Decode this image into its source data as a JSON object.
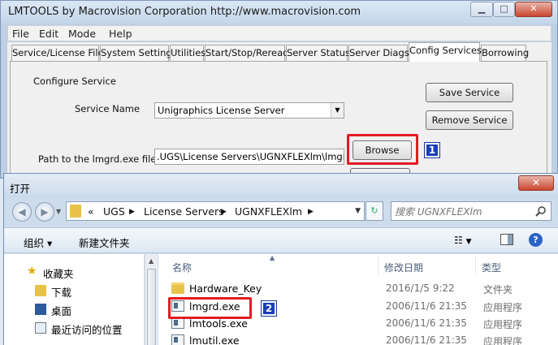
{
  "lmtools": {
    "title": "LMTOOLS by Macrovision Corporation http://www.macrovision.com",
    "menu": [
      "File",
      "Edit",
      "Mode",
      "Help"
    ],
    "tabs": [
      "Service/License File",
      "System Settings",
      "Utilities",
      "Start/Stop/Reread",
      "Server Status",
      "Server Diags",
      "Config Services",
      "Borrowing"
    ],
    "active_tab": "Config Services",
    "panel": {
      "group_label": "Configure Service",
      "service_name_label": "Service Name",
      "service_name_value": "Unigraphics License Server",
      "path_label": "Path to the lmgrd.exe file",
      "path_value": ".UGS\\License Servers\\UGNXFLEXlm\\lmgrd.exe",
      "save_service": "Save Service",
      "remove_service": "Remove Service",
      "browse": "Browse",
      "badge_1": "1"
    }
  },
  "dialog": {
    "title": "打开",
    "breadcrumb": [
      "«",
      "UGS",
      "License Servers",
      "UGNXFLEXlm"
    ],
    "search_placeholder": "搜索 UGNXFLEXlm",
    "toolbar": {
      "organize": "组织 ▾",
      "new_folder": "新建文件夹"
    },
    "nav_items": [
      "收藏夹",
      "下载",
      "桌面",
      "最近访问的位置"
    ],
    "columns": {
      "name": "名称",
      "date": "修改日期",
      "type": "类型"
    },
    "files": [
      {
        "name": "Hardware_Key",
        "date": "2016/1/5 9:22",
        "type": "文件夹",
        "kind": "folder"
      },
      {
        "name": "lmgrd.exe",
        "date": "2006/11/6 21:35",
        "type": "应用程序",
        "kind": "exe"
      },
      {
        "name": "lmtools.exe",
        "date": "2006/11/6 21:35",
        "type": "应用程序",
        "kind": "exe"
      },
      {
        "name": "lmutil.exe",
        "date": "2006/11/6 21:35",
        "type": "应用程序",
        "kind": "exe"
      }
    ],
    "badge_2": "2"
  },
  "colors": {
    "highlight_box": "#e21b22",
    "badge_bg": "#1a3fb7"
  }
}
